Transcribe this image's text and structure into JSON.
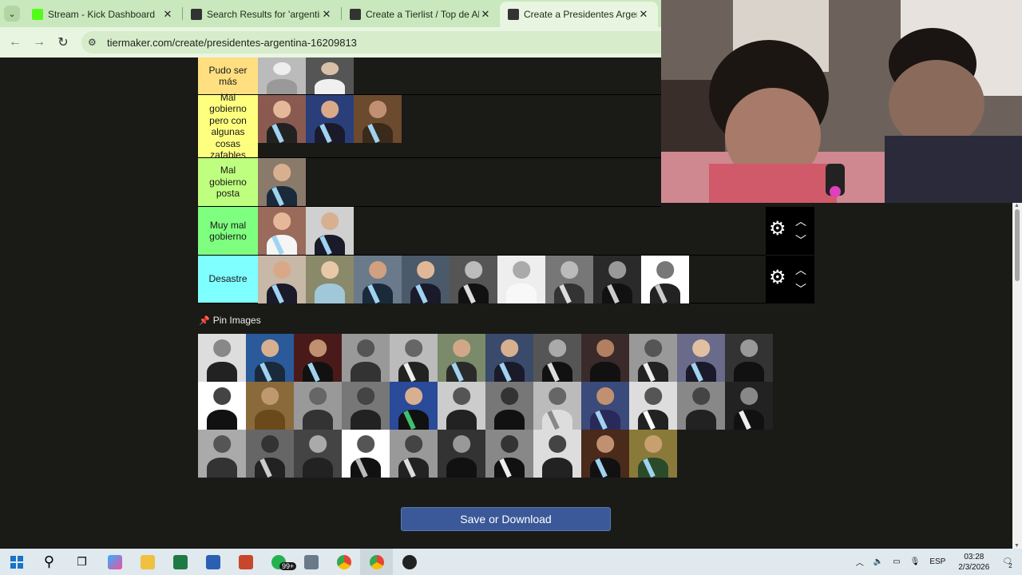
{
  "browser": {
    "tabs": [
      {
        "title": "Stream - Kick Dashboard",
        "favicon_color": "#53fc18",
        "active": false
      },
      {
        "title": "Search Results for 'argentina' -",
        "favicon_color": "#333333",
        "active": false
      },
      {
        "title": "Create a Tierlist / Top de Alfajo",
        "favicon_color": "#333333",
        "active": false
      },
      {
        "title": "Create a Presidentes Argentina",
        "favicon_color": "#333333",
        "active": true
      }
    ],
    "url": "tiermaker.com/create/presidentes-argentina-16209813"
  },
  "tiers": [
    {
      "label": "Pudo ser más",
      "color": "#ffdf80",
      "images": 2
    },
    {
      "label": "Mal gobierno pero con algunas cosas zafables",
      "color": "#ffff7f",
      "images": 3
    },
    {
      "label": "Mal gobierno posta",
      "color": "#bfff7f",
      "images": 1
    },
    {
      "label": "Muy mal gobierno",
      "color": "#7fff7f",
      "images": 2
    },
    {
      "label": "Desastre",
      "color": "#7fffff",
      "images": 9
    }
  ],
  "pin_images_label": "Pin Images",
  "save_button_label": "Save or Download",
  "taskbar": {
    "whatsapp_badge": "99+",
    "language": "ESP",
    "time": "03:28",
    "date": "2/3/2026",
    "notifications": "2"
  },
  "colors": {
    "page_bg": "#1a1a17",
    "save_button": "#3b5998",
    "browser_chrome": "#c9e8bd"
  }
}
